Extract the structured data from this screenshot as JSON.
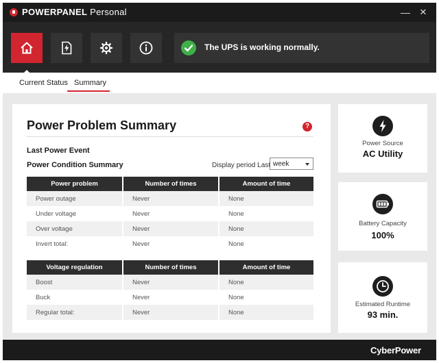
{
  "window": {
    "title_bold": "POWERPANEL",
    "title_rest": " Personal",
    "minimize_glyph": "—",
    "close_glyph": "✕"
  },
  "nav": {
    "items": [
      {
        "icon": "home-icon",
        "active": true
      },
      {
        "icon": "bolt-file-icon",
        "active": false
      },
      {
        "icon": "gear-icon",
        "active": false
      },
      {
        "icon": "info-icon",
        "active": false
      }
    ]
  },
  "status": {
    "message": "The UPS is working normally.",
    "state": "ok"
  },
  "tabs": {
    "current_status": "Current Status",
    "summary": "Summary",
    "selected": "Summary"
  },
  "summary": {
    "title": "Power Problem Summary",
    "help_glyph": "?",
    "last_power_event": "Last Power Event",
    "power_condition_summary": "Power Condition Summary",
    "period_label": "Display period Last",
    "period_value": "week"
  },
  "power_table": {
    "headers": [
      "Power problem",
      "Number of times",
      "Amount of time"
    ],
    "rows": [
      [
        "Power outage",
        "Never",
        "None"
      ],
      [
        "Under voltage",
        "Never",
        "None"
      ],
      [
        "Over voltage",
        "Never",
        "None"
      ],
      [
        "Invert total:",
        "Never",
        "None"
      ]
    ]
  },
  "voltage_table": {
    "headers": [
      "Voltage regulation",
      "Number of times",
      "Amount of time"
    ],
    "rows": [
      [
        "Boost",
        "Never",
        "None"
      ],
      [
        "Buck",
        "Never",
        "None"
      ],
      [
        "Regular total:",
        "Never",
        "None"
      ]
    ]
  },
  "side": {
    "power_source_label": "Power Source",
    "power_source_value": "AC Utility",
    "battery_label": "Battery Capacity",
    "battery_value": "100%",
    "battery_level": 1.0,
    "runtime_label": "Estimated Runtime",
    "runtime_value": "93 min."
  },
  "footer": {
    "brand": "CyberPower"
  },
  "colors": {
    "accent": "#d1252f",
    "ok": "#3fb049",
    "dark": "#1b1b1b",
    "panel": "#333333"
  }
}
